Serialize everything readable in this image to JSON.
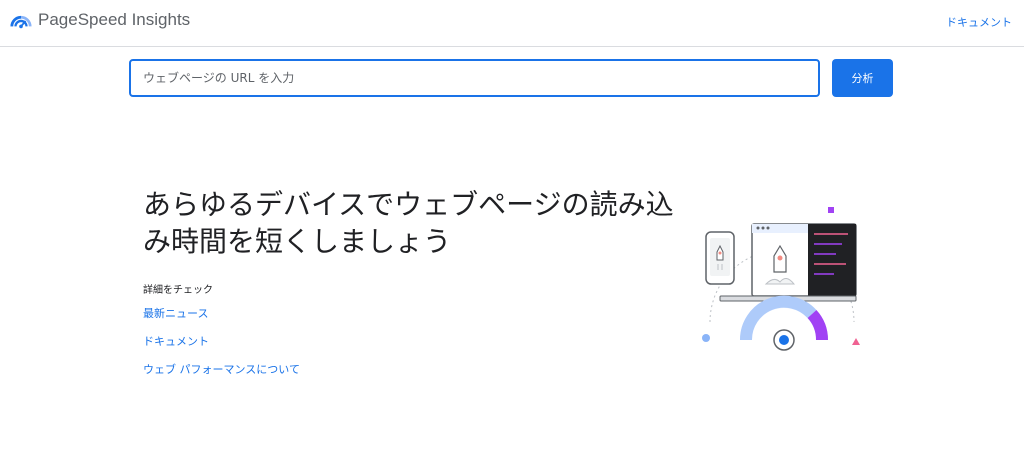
{
  "header": {
    "logo_icon": "pagespeed-gauge-icon",
    "title": "PageSpeed Insights",
    "doc_link": "ドキュメント"
  },
  "search": {
    "placeholder": "ウェブページの URL を入力",
    "value": "",
    "button_label": "分析"
  },
  "hero": {
    "title": "あらゆるデバイスでウェブページの読み込み時間を短くしましょう"
  },
  "learn_more": {
    "heading": "詳細をチェック",
    "links": [
      {
        "label": "最新ニュース"
      },
      {
        "label": "ドキュメント"
      },
      {
        "label": "ウェブ パフォーマンスについて"
      }
    ]
  },
  "illustration": {
    "name": "devices-speed-gauge-illustration"
  },
  "colors": {
    "primary": "#1a73e8",
    "text": "#202124",
    "muted": "#5f6368",
    "divider": "#dadce0",
    "accent_purple": "#a142f4",
    "accent_pink": "#f06292",
    "light_blue": "#8ab4f8"
  }
}
